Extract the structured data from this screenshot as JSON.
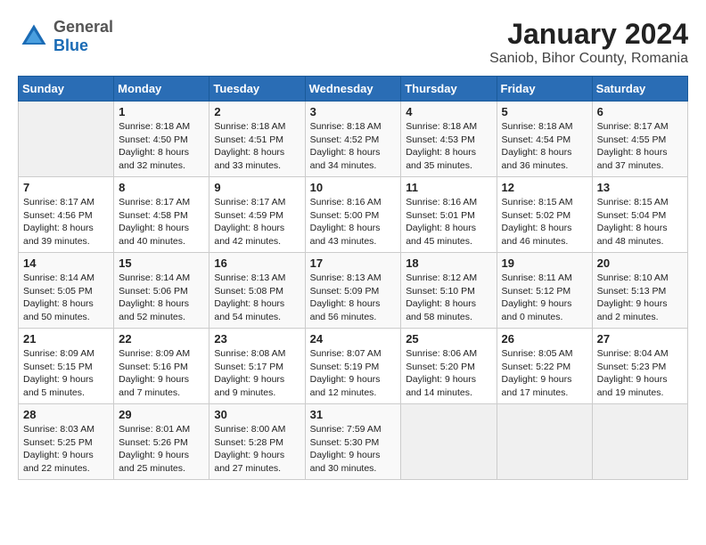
{
  "logo": {
    "general": "General",
    "blue": "Blue"
  },
  "title": "January 2024",
  "subtitle": "Saniob, Bihor County, Romania",
  "weekdays": [
    "Sunday",
    "Monday",
    "Tuesday",
    "Wednesday",
    "Thursday",
    "Friday",
    "Saturday"
  ],
  "weeks": [
    [
      {
        "day": "",
        "info": ""
      },
      {
        "day": "1",
        "info": "Sunrise: 8:18 AM\nSunset: 4:50 PM\nDaylight: 8 hours\nand 32 minutes."
      },
      {
        "day": "2",
        "info": "Sunrise: 8:18 AM\nSunset: 4:51 PM\nDaylight: 8 hours\nand 33 minutes."
      },
      {
        "day": "3",
        "info": "Sunrise: 8:18 AM\nSunset: 4:52 PM\nDaylight: 8 hours\nand 34 minutes."
      },
      {
        "day": "4",
        "info": "Sunrise: 8:18 AM\nSunset: 4:53 PM\nDaylight: 8 hours\nand 35 minutes."
      },
      {
        "day": "5",
        "info": "Sunrise: 8:18 AM\nSunset: 4:54 PM\nDaylight: 8 hours\nand 36 minutes."
      },
      {
        "day": "6",
        "info": "Sunrise: 8:17 AM\nSunset: 4:55 PM\nDaylight: 8 hours\nand 37 minutes."
      }
    ],
    [
      {
        "day": "7",
        "info": "Sunrise: 8:17 AM\nSunset: 4:56 PM\nDaylight: 8 hours\nand 39 minutes."
      },
      {
        "day": "8",
        "info": "Sunrise: 8:17 AM\nSunset: 4:58 PM\nDaylight: 8 hours\nand 40 minutes."
      },
      {
        "day": "9",
        "info": "Sunrise: 8:17 AM\nSunset: 4:59 PM\nDaylight: 8 hours\nand 42 minutes."
      },
      {
        "day": "10",
        "info": "Sunrise: 8:16 AM\nSunset: 5:00 PM\nDaylight: 8 hours\nand 43 minutes."
      },
      {
        "day": "11",
        "info": "Sunrise: 8:16 AM\nSunset: 5:01 PM\nDaylight: 8 hours\nand 45 minutes."
      },
      {
        "day": "12",
        "info": "Sunrise: 8:15 AM\nSunset: 5:02 PM\nDaylight: 8 hours\nand 46 minutes."
      },
      {
        "day": "13",
        "info": "Sunrise: 8:15 AM\nSunset: 5:04 PM\nDaylight: 8 hours\nand 48 minutes."
      }
    ],
    [
      {
        "day": "14",
        "info": "Sunrise: 8:14 AM\nSunset: 5:05 PM\nDaylight: 8 hours\nand 50 minutes."
      },
      {
        "day": "15",
        "info": "Sunrise: 8:14 AM\nSunset: 5:06 PM\nDaylight: 8 hours\nand 52 minutes."
      },
      {
        "day": "16",
        "info": "Sunrise: 8:13 AM\nSunset: 5:08 PM\nDaylight: 8 hours\nand 54 minutes."
      },
      {
        "day": "17",
        "info": "Sunrise: 8:13 AM\nSunset: 5:09 PM\nDaylight: 8 hours\nand 56 minutes."
      },
      {
        "day": "18",
        "info": "Sunrise: 8:12 AM\nSunset: 5:10 PM\nDaylight: 8 hours\nand 58 minutes."
      },
      {
        "day": "19",
        "info": "Sunrise: 8:11 AM\nSunset: 5:12 PM\nDaylight: 9 hours\nand 0 minutes."
      },
      {
        "day": "20",
        "info": "Sunrise: 8:10 AM\nSunset: 5:13 PM\nDaylight: 9 hours\nand 2 minutes."
      }
    ],
    [
      {
        "day": "21",
        "info": "Sunrise: 8:09 AM\nSunset: 5:15 PM\nDaylight: 9 hours\nand 5 minutes."
      },
      {
        "day": "22",
        "info": "Sunrise: 8:09 AM\nSunset: 5:16 PM\nDaylight: 9 hours\nand 7 minutes."
      },
      {
        "day": "23",
        "info": "Sunrise: 8:08 AM\nSunset: 5:17 PM\nDaylight: 9 hours\nand 9 minutes."
      },
      {
        "day": "24",
        "info": "Sunrise: 8:07 AM\nSunset: 5:19 PM\nDaylight: 9 hours\nand 12 minutes."
      },
      {
        "day": "25",
        "info": "Sunrise: 8:06 AM\nSunset: 5:20 PM\nDaylight: 9 hours\nand 14 minutes."
      },
      {
        "day": "26",
        "info": "Sunrise: 8:05 AM\nSunset: 5:22 PM\nDaylight: 9 hours\nand 17 minutes."
      },
      {
        "day": "27",
        "info": "Sunrise: 8:04 AM\nSunset: 5:23 PM\nDaylight: 9 hours\nand 19 minutes."
      }
    ],
    [
      {
        "day": "28",
        "info": "Sunrise: 8:03 AM\nSunset: 5:25 PM\nDaylight: 9 hours\nand 22 minutes."
      },
      {
        "day": "29",
        "info": "Sunrise: 8:01 AM\nSunset: 5:26 PM\nDaylight: 9 hours\nand 25 minutes."
      },
      {
        "day": "30",
        "info": "Sunrise: 8:00 AM\nSunset: 5:28 PM\nDaylight: 9 hours\nand 27 minutes."
      },
      {
        "day": "31",
        "info": "Sunrise: 7:59 AM\nSunset: 5:30 PM\nDaylight: 9 hours\nand 30 minutes."
      },
      {
        "day": "",
        "info": ""
      },
      {
        "day": "",
        "info": ""
      },
      {
        "day": "",
        "info": ""
      }
    ]
  ]
}
